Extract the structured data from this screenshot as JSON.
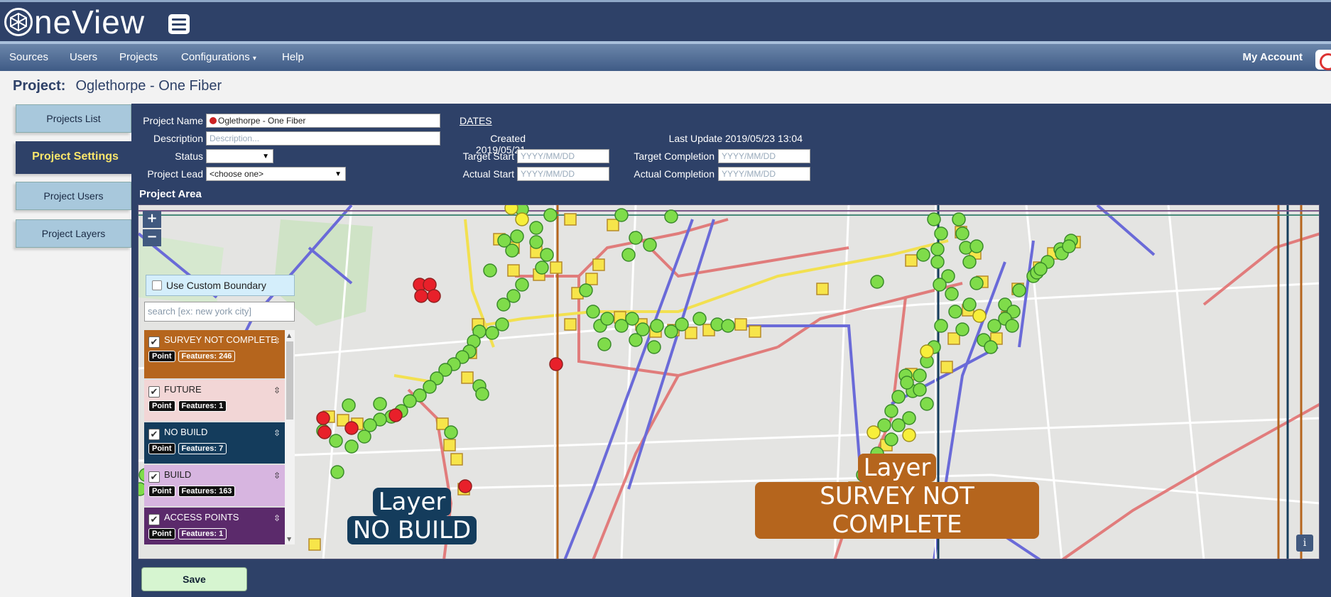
{
  "app": {
    "logo_text": "neView"
  },
  "nav": {
    "items": [
      "Sources",
      "Users",
      "Projects",
      "Configurations",
      "Help"
    ],
    "configurations_caret": "▾",
    "account": "My Account"
  },
  "project": {
    "label": "Project:",
    "name": "Oglethorpe - One Fiber"
  },
  "side_tabs": [
    "Projects List",
    "Project Settings",
    "Project Users",
    "Project Layers"
  ],
  "form": {
    "project_name_label": "Project Name",
    "project_name_value": "Oglethorpe - One Fiber",
    "description_label": "Description",
    "description_placeholder": "Description...",
    "status_label": "Status",
    "status_value": "",
    "project_lead_label": "Project Lead",
    "project_lead_value": "<choose one>",
    "dates_heading": "DATES",
    "created_label": "Created",
    "created_value": "2019/05/21",
    "last_update_label": "Last Update",
    "last_update_value": "2019/05/23 13:04",
    "target_start_label": "Target Start",
    "target_start_placeholder": "YYYY/MM/DD",
    "target_completion_label": "Target Completion",
    "target_completion_placeholder": "YYYY/MM/DD",
    "actual_start_label": "Actual Start",
    "actual_start_placeholder": "YYYY/MM/DD",
    "actual_completion_label": "Actual Completion",
    "actual_completion_placeholder": "YYYY/MM/DD"
  },
  "map": {
    "heading": "Project Area",
    "zoom_in": "+",
    "zoom_out": "−",
    "custom_boundary_label": "Use Custom Boundary",
    "search_placeholder": "search [ex: new york city]",
    "layers": [
      {
        "name": "SURVEY NOT COMPLETE",
        "type": "Point",
        "features": "Features: 246",
        "color": "#b5651d",
        "checked": true
      },
      {
        "name": "FUTURE",
        "type": "Point",
        "features": "Features: 1",
        "color": "#f2d6d6",
        "checked": true
      },
      {
        "name": "NO BUILD",
        "type": "Point",
        "features": "Features: 7",
        "color": "#143c5c",
        "checked": true
      },
      {
        "name": "BUILD",
        "type": "Point",
        "features": "Features: 163",
        "color": "#d7b5e0",
        "checked": true
      },
      {
        "name": "ACCESS POINTS",
        "type": "Point",
        "features": "Features: 1",
        "color": "#5b2a6b",
        "checked": true
      }
    ],
    "label_no_build_line1": "Layer",
    "label_no_build_line2": "NO BUILD",
    "label_survey_line1": "Layer",
    "label_survey_line2": "SURVEY NOT COMPLETE",
    "info": "i"
  },
  "save_label": "Save",
  "colors": {
    "header": "#2e4168",
    "active_tab_text": "#fbe66b",
    "survey": "#b5651d",
    "no_build": "#143c5c"
  }
}
